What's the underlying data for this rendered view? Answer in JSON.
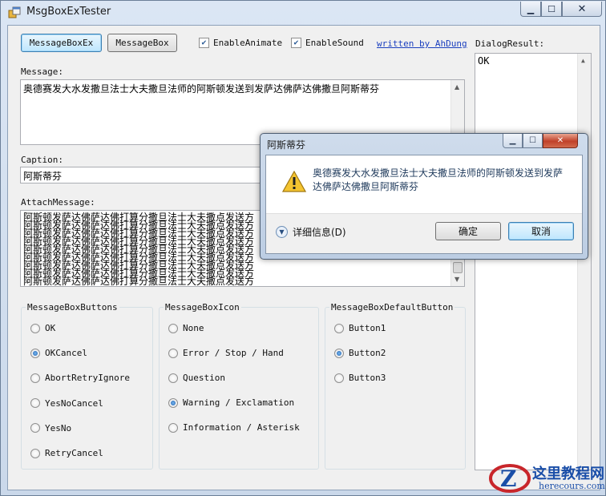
{
  "window": {
    "title": "MsgBoxExTester"
  },
  "toolbar": {
    "messageboxex_label": "MessageBoxEx",
    "messagebox_label": "MessageBox",
    "enable_animate": {
      "label": "EnableAnimate",
      "checked": true
    },
    "enable_sound": {
      "label": "EnableSound",
      "checked": true
    },
    "author_link": "written by AhDung"
  },
  "dialog_result": {
    "label": "DialogResult:",
    "value": "OK"
  },
  "message": {
    "label": "Message:",
    "value": "奥德赛发大水发撒旦法士大夫撒旦法师的阿斯顿发送到发萨达佛萨达佛撒旦阿斯蒂芬"
  },
  "caption": {
    "label": "Caption:",
    "value": "阿斯蒂芬"
  },
  "attach_message": {
    "label": "AttachMessage:",
    "lines": [
      "阿斯顿发萨达佛萨达佛打算分撒旦法士大夫撒点发送方",
      "阿斯顿发萨达佛萨达佛打算分撒旦法士大夫撒点发送方",
      "阿斯顿发萨达佛萨达佛打算分撒旦法士大夫撒点发送方",
      "阿斯顿发萨达佛萨达佛打算分撒旦法士大夫撒点发送方",
      "阿斯顿发萨达佛萨达佛打算分撒旦法士大夫撒点发送方",
      "阿斯顿发萨达佛萨达佛打算分撒旦法士大夫撒点发送方",
      "阿斯顿发萨达佛萨达佛打算分撒旦法士大夫撒点发送方",
      "阿斯顿发萨达佛萨达佛打算分撒旦法士大夫撒点发送方",
      "阿斯顿发萨达佛萨达佛打算分撒旦法士大夫撒点发送方"
    ]
  },
  "buttons_group": {
    "title": "MessageBoxButtons",
    "options": [
      {
        "label": "OK",
        "selected": false
      },
      {
        "label": "OKCancel",
        "selected": true
      },
      {
        "label": "AbortRetryIgnore",
        "selected": false
      },
      {
        "label": "YesNoCancel",
        "selected": false
      },
      {
        "label": "YesNo",
        "selected": false
      },
      {
        "label": "RetryCancel",
        "selected": false
      }
    ]
  },
  "icon_group": {
    "title": "MessageBoxIcon",
    "options": [
      {
        "label": "None",
        "selected": false
      },
      {
        "label": "Error / Stop / Hand",
        "selected": false
      },
      {
        "label": "Question",
        "selected": false
      },
      {
        "label": "Warning / Exclamation",
        "selected": true
      },
      {
        "label": "Information / Asterisk",
        "selected": false
      }
    ]
  },
  "default_button_group": {
    "title": "MessageBoxDefaultButton",
    "options": [
      {
        "label": "Button1",
        "selected": false
      },
      {
        "label": "Button2",
        "selected": true
      },
      {
        "label": "Button3",
        "selected": false
      }
    ]
  },
  "dialog": {
    "title": "阿斯蒂芬",
    "message": "奥德赛发大水发撒旦法士大夫撒旦法师的阿斯顿发送到发萨达佛萨达佛撒旦阿斯蒂芬",
    "details_label": "详细信息(D)",
    "ok_label": "确定",
    "cancel_label": "取消"
  },
  "watermark": {
    "name": "这里教程网",
    "url": "herecours.com"
  }
}
